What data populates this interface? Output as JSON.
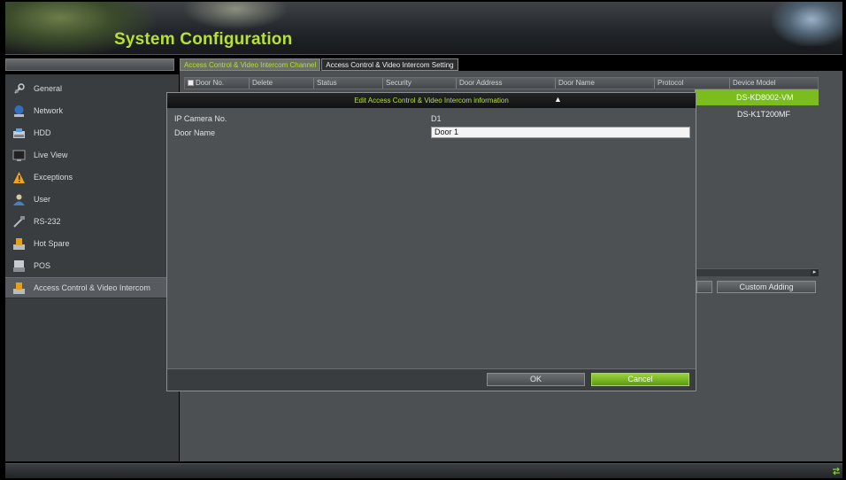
{
  "header": {
    "title": "System Configuration"
  },
  "tabs": [
    {
      "label": "Access Control & Video Intercom Channel",
      "active": true
    },
    {
      "label": "Access Control & Video Intercom Setting",
      "active": false
    }
  ],
  "sidebar": {
    "items": [
      {
        "label": "General",
        "icon": "wrench-icon"
      },
      {
        "label": "Network",
        "icon": "network-icon"
      },
      {
        "label": "HDD",
        "icon": "hdd-icon"
      },
      {
        "label": "Live View",
        "icon": "monitor-icon"
      },
      {
        "label": "Exceptions",
        "icon": "warning-icon"
      },
      {
        "label": "User",
        "icon": "user-icon"
      },
      {
        "label": "RS-232",
        "icon": "serial-icon"
      },
      {
        "label": "Hot Spare",
        "icon": "hot-spare-icon"
      },
      {
        "label": "POS",
        "icon": "pos-icon"
      },
      {
        "label": "Access Control & Video Intercom",
        "icon": "intercom-icon",
        "active": true
      }
    ]
  },
  "table": {
    "columns": [
      "Door No.",
      "Delete",
      "Status",
      "Security",
      "Door Address",
      "Door Name",
      "Protocol",
      "Device Model"
    ],
    "rows": [
      {
        "device_model": "DS-KD8002-VM",
        "selected": true
      },
      {
        "device_model": "DS-K1T200MF",
        "selected": false
      }
    ]
  },
  "buttons": {
    "custom_adding": "Custom Adding"
  },
  "dialog": {
    "title": "Edit Access Control & Video Intercom information",
    "fields": {
      "camera_no_label": "IP Camera No.",
      "camera_no_value": "D1",
      "door_name_label": "Door Name",
      "door_name_value": "Door 1"
    },
    "ok_label": "OK",
    "cancel_label": "Cancel"
  },
  "colors": {
    "accent_green": "#7bbd1f",
    "title_green": "#b7e233",
    "panel_gray": "#4d5053"
  }
}
